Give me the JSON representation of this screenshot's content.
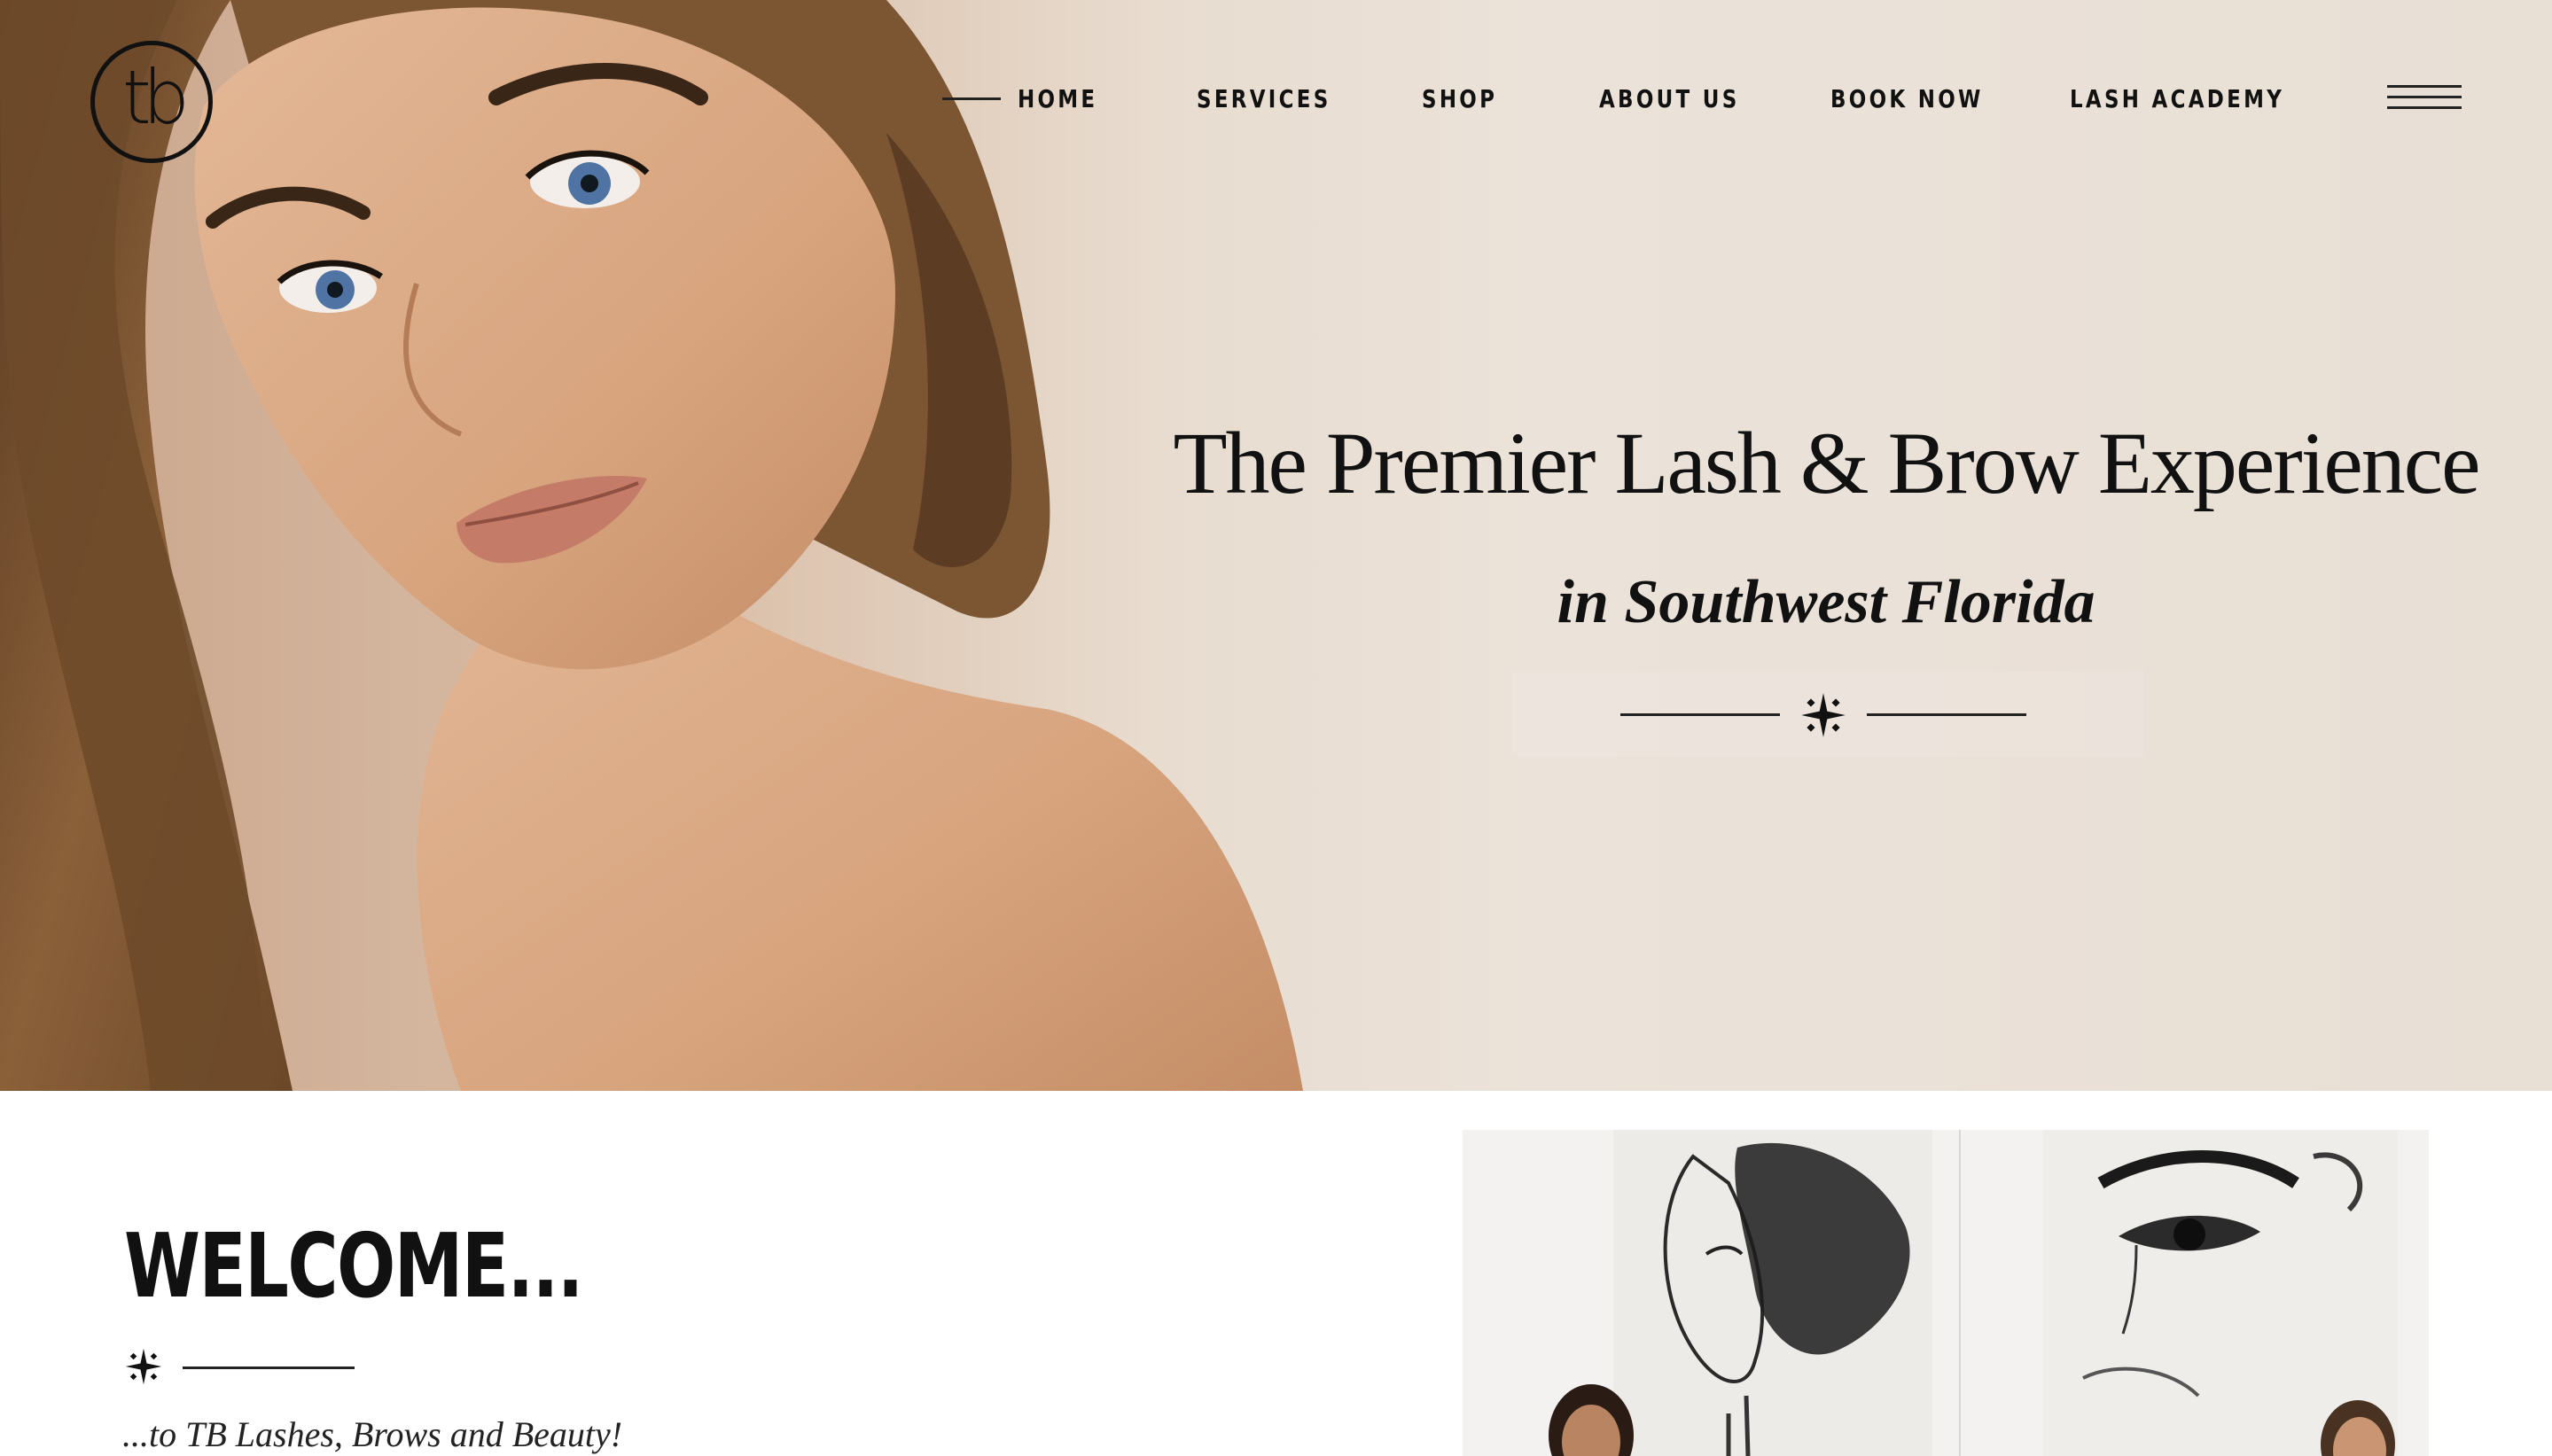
{
  "brand": {
    "logo_text": "tb"
  },
  "nav": {
    "items": [
      {
        "label": "HOME"
      },
      {
        "label": "SERVICES"
      },
      {
        "label": "SHOP"
      },
      {
        "label": "ABOUT US"
      },
      {
        "label": "BOOK NOW"
      },
      {
        "label": "LASH ACADEMY"
      }
    ],
    "menu_icon": "hamburger-icon"
  },
  "hero": {
    "headline": "The Premier Lash & Brow Experience",
    "subhead": "in Southwest Florida",
    "ornament_icon": "sparkle-icon"
  },
  "welcome": {
    "title": "WELCOME...",
    "subtitle": "...to TB Lashes, Brows and Beauty!",
    "ornament_icon": "sparkle-icon"
  },
  "colors": {
    "text": "#111111",
    "hero_background": "#ebe2d9",
    "skin": "#d9a983",
    "hair": "#7a5331"
  }
}
